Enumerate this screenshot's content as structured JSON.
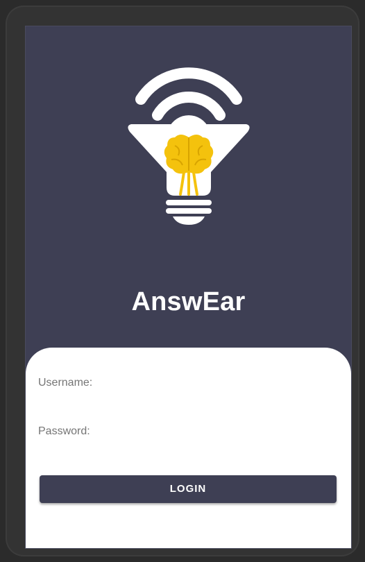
{
  "app": {
    "title": "AnswEar"
  },
  "logo": {
    "icon": "lightbulb-brain-signal-icon",
    "bulb_color": "#ffffff",
    "brain_color": "#f4c20d"
  },
  "login_form": {
    "username_label": "Username:",
    "username_value": "",
    "password_label": "Password:",
    "password_value": "",
    "login_label": "LOGIN"
  },
  "colors": {
    "primary": "#3e3f54",
    "card_background": "#ffffff",
    "label_text": "#757575"
  }
}
